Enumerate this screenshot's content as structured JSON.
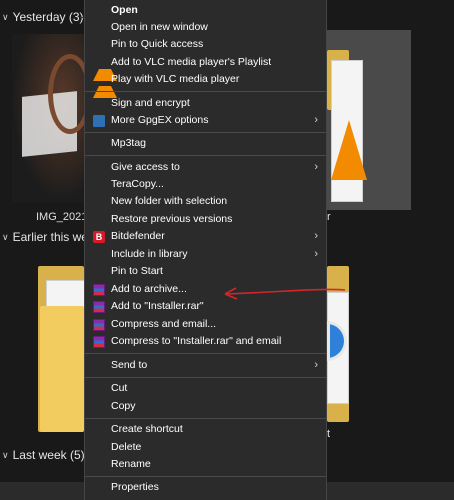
{
  "groups": {
    "yesterday": "Yesterday (3)",
    "earlier": "Earlier this we",
    "last_week": "Last week (5)"
  },
  "files": {
    "img_label": "IMG_20210",
    "right_label_1": "r",
    "right_label_2": "t"
  },
  "menu": {
    "open": "Open",
    "open_new_window": "Open in new window",
    "pin_quick_access": "Pin to Quick access",
    "vlc_playlist": "Add to VLC media player's Playlist",
    "vlc_play": "Play with VLC media player",
    "sign_encrypt": "Sign and encrypt",
    "gpgex": "More GpgEX options",
    "mp3tag": "Mp3tag",
    "give_access": "Give access to",
    "teracopy": "TeraCopy...",
    "new_folder_selection": "New folder with selection",
    "restore_versions": "Restore previous versions",
    "bitdefender": "Bitdefender",
    "include_library": "Include in library",
    "pin_start": "Pin to Start",
    "add_archive": "Add to archive...",
    "add_installer_rar": "Add to \"Installer.rar\"",
    "compress_email": "Compress and email...",
    "compress_installer_email": "Compress to \"Installer.rar\" and email",
    "send_to": "Send to",
    "cut": "Cut",
    "copy": "Copy",
    "create_shortcut": "Create shortcut",
    "delete": "Delete",
    "rename": "Rename",
    "properties": "Properties"
  },
  "icons": {
    "vlc": "vlc-cone-icon",
    "gpgex": "gpgex-icon",
    "bitdefender": "bitdefender-icon",
    "bitdefender_letter": "B",
    "winrar": "winrar-icon",
    "submenu_arrow": "›",
    "chevron": "∨"
  },
  "colors": {
    "menu_bg": "#2b2b2b",
    "annotation_arrow": "#d0262a"
  }
}
